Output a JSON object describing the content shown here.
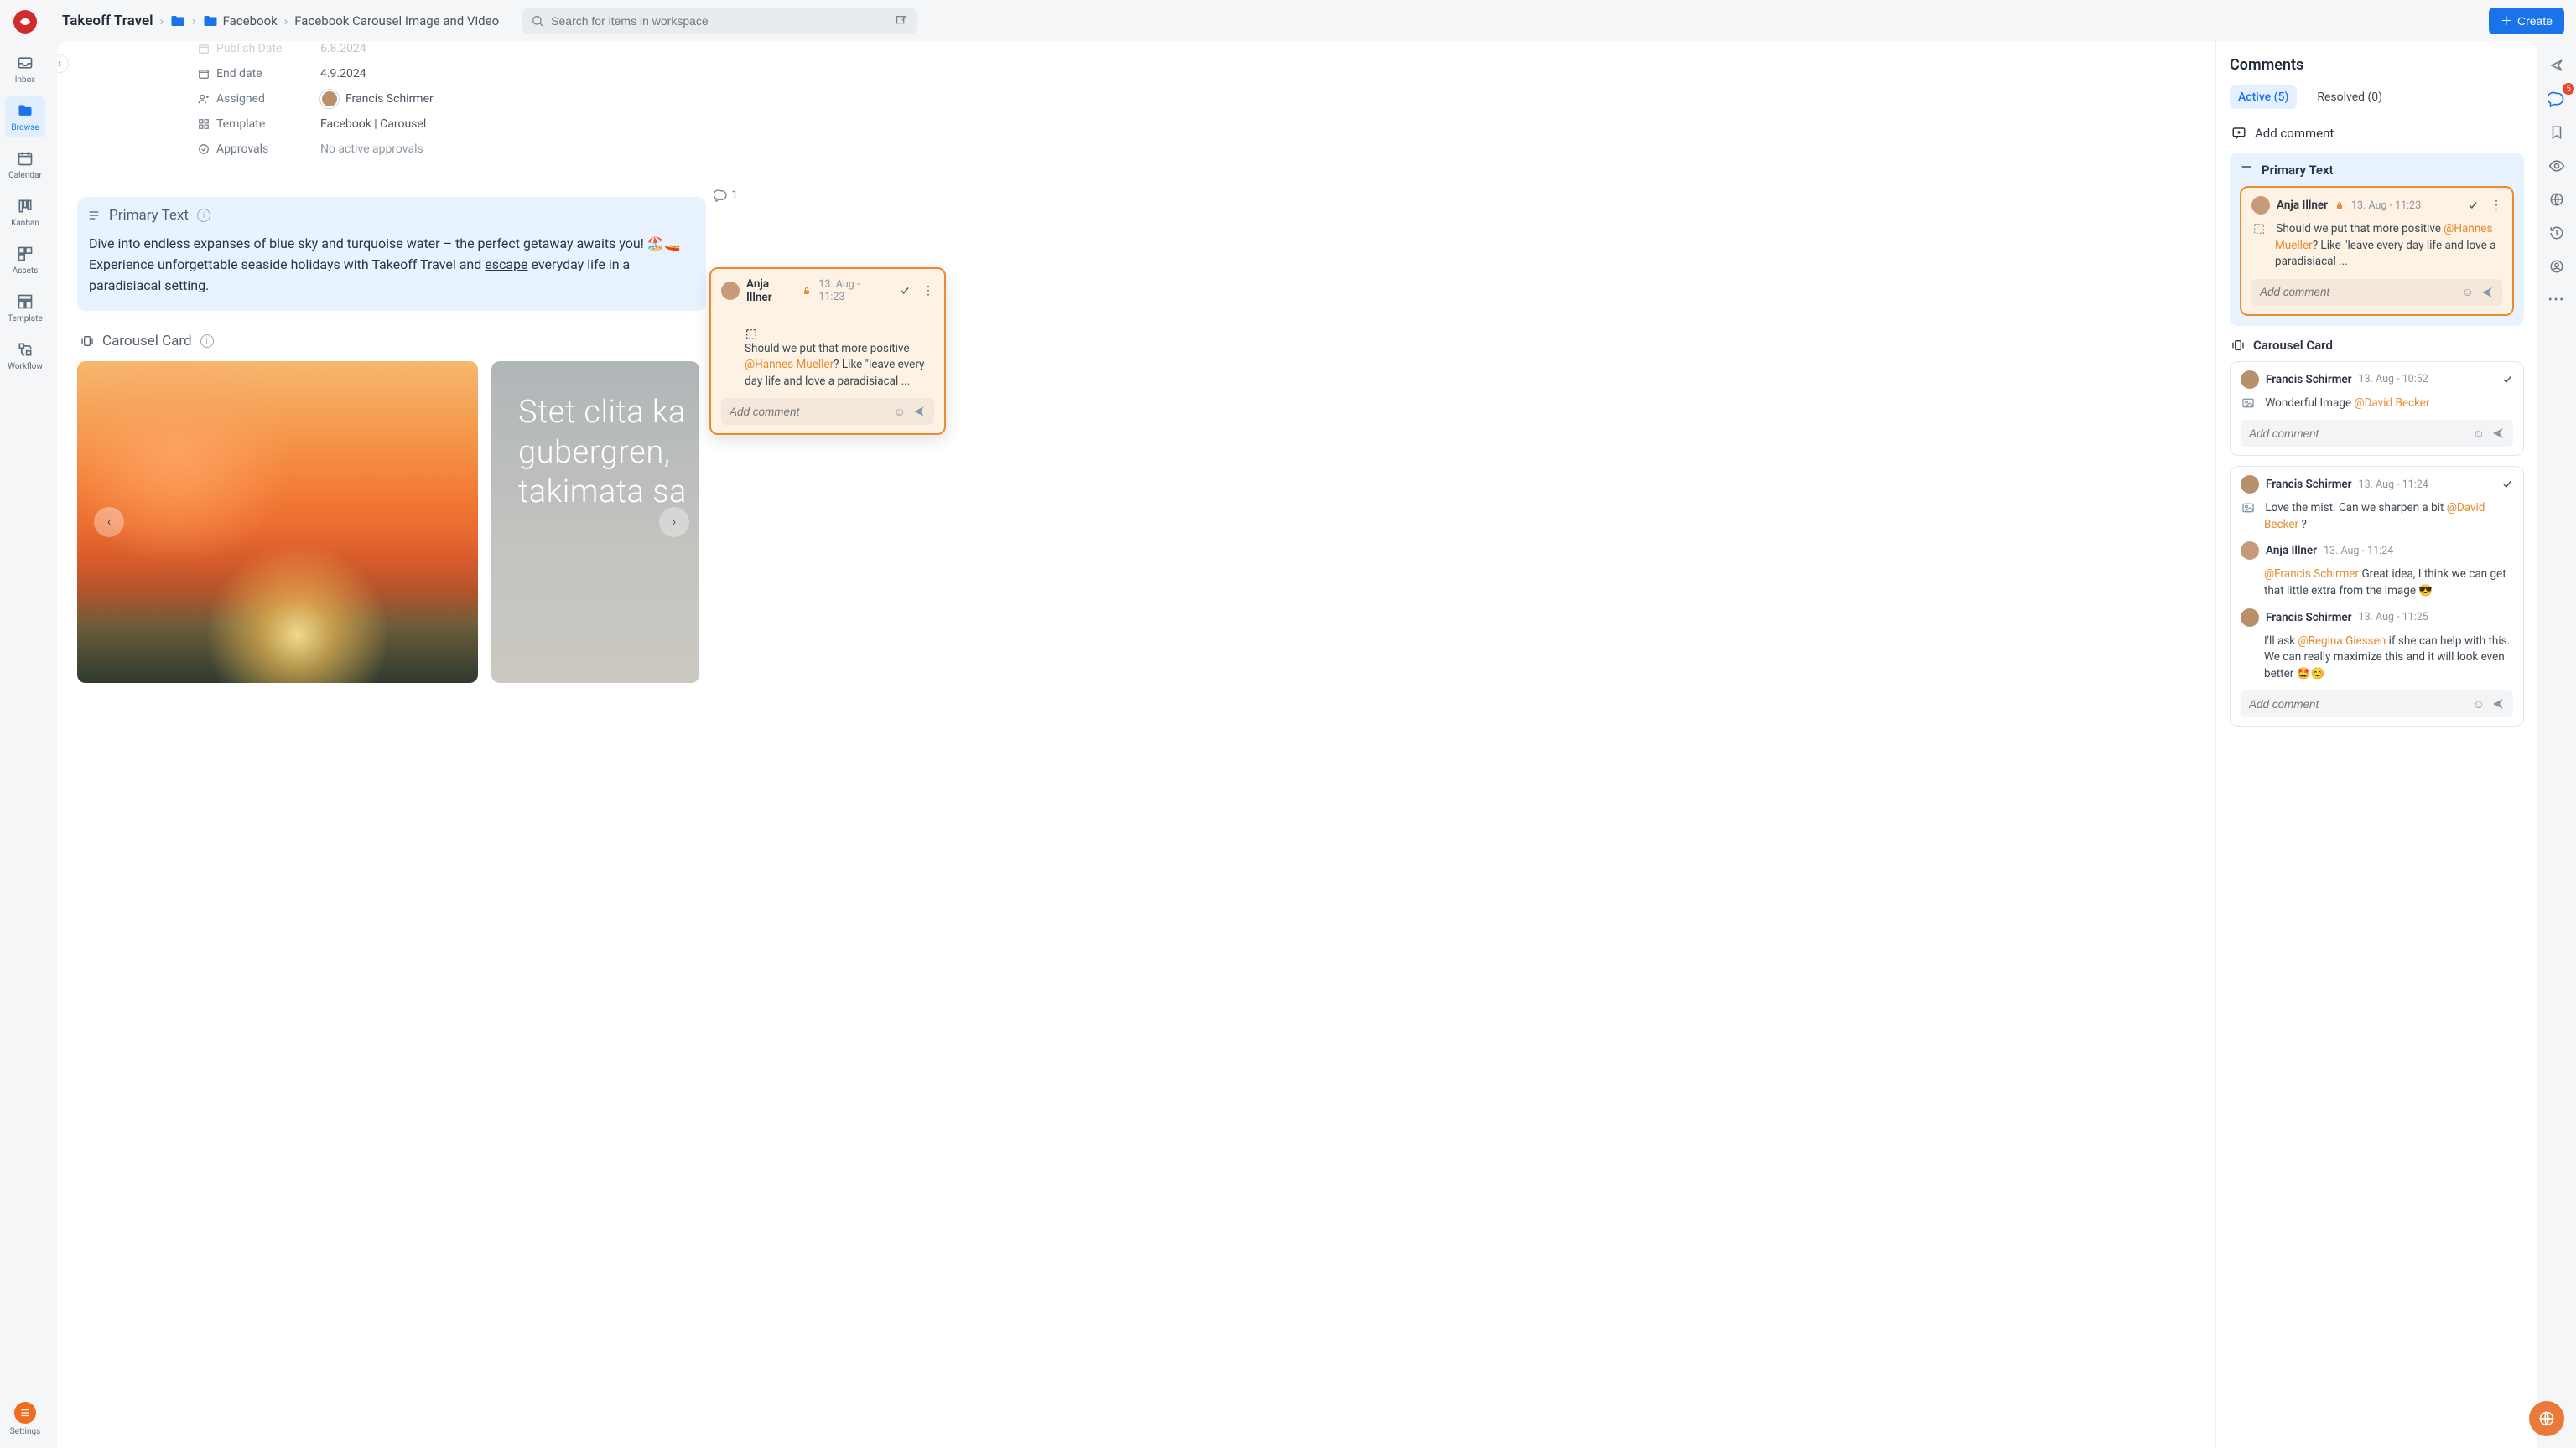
{
  "topbar": {
    "workspace": "Takeoff Travel",
    "crumb_folder1": "Facebook",
    "crumb_item": "Facebook Carousel Image and Video",
    "search_placeholder": "Search for items in workspace",
    "create_label": "Create"
  },
  "rail": {
    "inbox": "Inbox",
    "browse": "Browse",
    "calendar": "Calendar",
    "kanban": "Kanban",
    "assets": "Assets",
    "template": "Template",
    "workflow": "Workflow",
    "settings": "Settings"
  },
  "meta": {
    "publish_label": "Publish Date",
    "publish_val": "6.8.2024",
    "end_label": "End date",
    "end_val": "4.9.2024",
    "assigned_label": "Assigned",
    "assigned_val": "Francis Schirmer",
    "template_label": "Template",
    "template_val": "Facebook | Carousel",
    "approvals_label": "Approvals",
    "approvals_val": "No active approvals"
  },
  "primary": {
    "title": "Primary Text",
    "text_a": "Dive into endless expanses of blue sky and turquoise water – the perfect getaway awaits you! 🏖️🚤 Experience unforgettable seaside holidays with Takeoff Travel and ",
    "text_u": "escape",
    "text_b": " everyday life in a paradisiacal setting.",
    "count": "1"
  },
  "carousel": {
    "title": "Carousel Card",
    "count": "2",
    "card2_line1": "Stet clita ka",
    "card2_line2": "gubergren,",
    "card2_line3": "takimata sa"
  },
  "popover": {
    "author": "Anja Illner",
    "ts": "13. Aug - 11:23",
    "msg_a": "Should we put that more positive ",
    "mention": "@Hannes Mueller",
    "msg_b": "? Like \"leave every day life and love a paradisiacal ...",
    "add_placeholder": "Add comment"
  },
  "comments": {
    "title": "Comments",
    "tab_active": "Active (5)",
    "tab_resolved": "Resolved (0)",
    "add_comment": "Add comment",
    "group1_title": "Primary Text",
    "group2_title": "Carousel Card",
    "badge": "5",
    "item1": {
      "author": "Anja Illner",
      "ts": "13. Aug - 11:23",
      "msg_a": "Should we put that more positive ",
      "mention": "@Hannes Mueller",
      "msg_b": "? Like \"leave every day life and love a paradisiacal ..."
    },
    "item2": {
      "author": "Francis Schirmer",
      "ts": "13. Aug - 10:52",
      "msg_a": "Wonderful Image ",
      "mention": "@David Becker"
    },
    "item3": {
      "author": "Francis Schirmer",
      "ts": "13. Aug - 11:24",
      "msg_a": "Love the mist. Can we sharpen a bit ",
      "mention": "@David Becker",
      "msg_b": " ?"
    },
    "item3r1": {
      "author": "Anja Illner",
      "ts": "13. Aug - 11:24",
      "mention": "@Francis Schirmer",
      "msg_b": " Great idea, I think we can get that little extra from the image 😎"
    },
    "item3r2": {
      "author": "Francis Schirmer",
      "ts": "13. Aug - 11:25",
      "msg_a": "I'll ask ",
      "mention": "@Regina Giessen",
      "msg_b": " if she can help with this. We can really maximize this and it will look even better 🤩😊"
    },
    "add_placeholder": "Add comment"
  }
}
